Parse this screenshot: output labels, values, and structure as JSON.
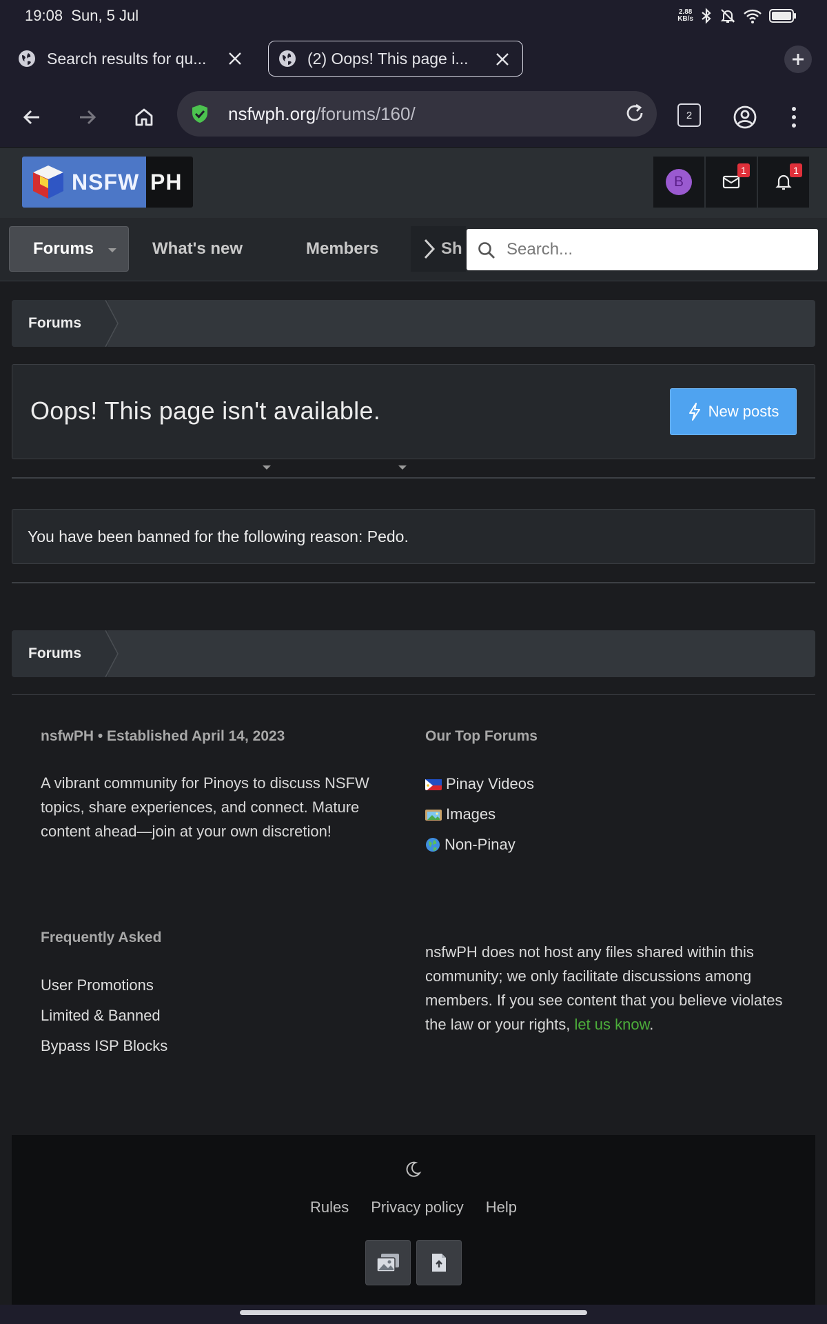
{
  "status_bar": {
    "time": "19:08",
    "date": "Sun, 5 Jul",
    "net_speed_value": "2.88",
    "net_speed_unit": "KB/s"
  },
  "browser": {
    "tabs": [
      {
        "title": "Search results for qu..."
      },
      {
        "title": "(2) Oops! This page i..."
      }
    ],
    "url_domain": "nsfwph.org",
    "url_path": "/forums/160/",
    "tab_count": "2"
  },
  "site": {
    "logo_left": "NSFW",
    "logo_right": "PH",
    "avatar_letter": "B",
    "inbox_badge": "1",
    "alerts_badge": "1",
    "nav": [
      {
        "label": "Forums"
      },
      {
        "label": "What's new"
      },
      {
        "label": "Members"
      }
    ],
    "nav_more_label": "Sh",
    "search_placeholder": "Search..."
  },
  "content": {
    "breadcrumb_top": "Forums",
    "page_title": "Oops! This page isn't available.",
    "new_posts_label": "New posts",
    "ban_notice": "You have been banned for the following reason: Pedo.",
    "breadcrumb_bottom": "Forums"
  },
  "footer": {
    "about_heading": "nsfwPH • Established April 14, 2023",
    "about_text": "A vibrant community for Pinoys to discuss NSFW topics, share experiences, and connect. Mature content ahead—join at your own discretion!",
    "top_forums_heading": "Our Top Forums",
    "top_forums": [
      {
        "label": "Pinay Videos",
        "icon": "philippines-flag-icon"
      },
      {
        "label": "Images",
        "icon": "framed-picture-icon"
      },
      {
        "label": "Non-Pinay",
        "icon": "globe-icon"
      }
    ],
    "faq_heading": "Frequently Asked",
    "faq_links": [
      {
        "label": "User Promotions"
      },
      {
        "label": "Limited & Banned"
      },
      {
        "label": "Bypass ISP Blocks"
      }
    ],
    "disclaimer_text": "nsfwPH does not host any files shared within this community; we only facilitate discussions among members. If you see content that you believe violates the law or your rights,",
    "disclaimer_link": "let us know",
    "disclaimer_end": ".",
    "bottom_links": [
      {
        "label": "Rules"
      },
      {
        "label": "Privacy policy"
      },
      {
        "label": "Help"
      }
    ]
  },
  "colors": {
    "accent_blue": "#4fa3f0",
    "link_green": "#4cae3a",
    "badge_red": "#e0303a",
    "avatar_purple": "#9a5ad0"
  }
}
